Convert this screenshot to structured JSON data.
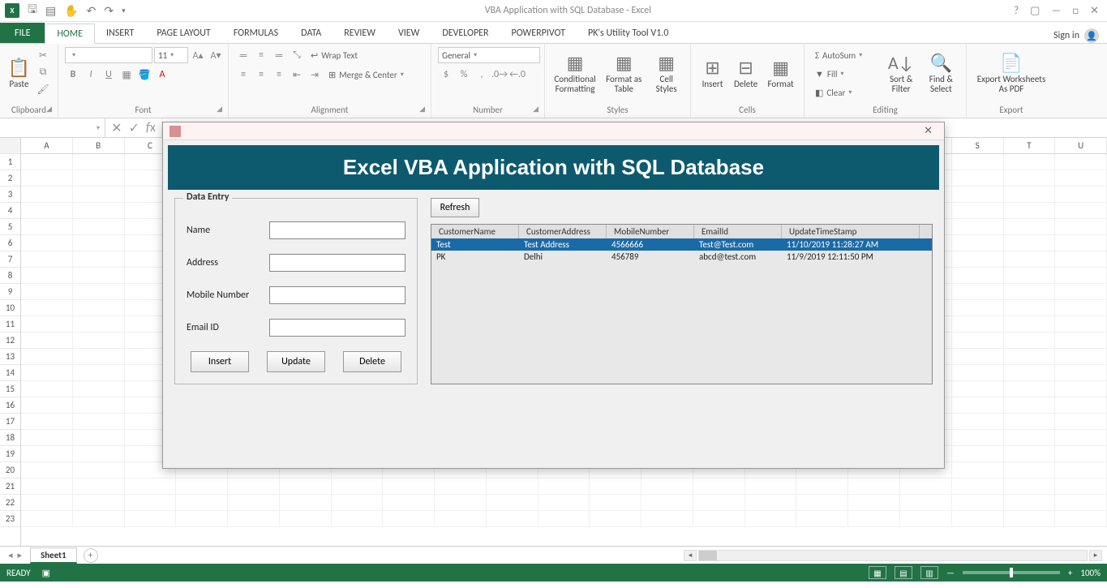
{
  "app": {
    "title": "VBA Application with SQL Database - Excel",
    "signin": "Sign in"
  },
  "qat_icons": [
    "save",
    "open",
    "touch",
    "undo",
    "redo"
  ],
  "ribbon_tabs": {
    "file": "FILE",
    "items": [
      "HOME",
      "INSERT",
      "PAGE LAYOUT",
      "FORMULAS",
      "DATA",
      "REVIEW",
      "VIEW",
      "DEVELOPER",
      "POWERPIVOT",
      "PK's Utility Tool V1.0"
    ],
    "active": "HOME"
  },
  "ribbon": {
    "clipboard": {
      "label": "Clipboard",
      "paste": "Paste"
    },
    "font": {
      "label": "Font",
      "name": "",
      "size": "11"
    },
    "alignment": {
      "label": "Alignment",
      "wrap": "Wrap Text",
      "merge": "Merge & Center"
    },
    "number": {
      "label": "Number",
      "format": "General"
    },
    "styles": {
      "label": "Styles",
      "cond": "Conditional Formatting",
      "table": "Format as Table",
      "cell": "Cell Styles"
    },
    "cells": {
      "label": "Cells",
      "insert": "Insert",
      "delete": "Delete",
      "format": "Format"
    },
    "editing": {
      "label": "Editing",
      "autosum": "AutoSum",
      "fill": "Fill",
      "clear": "Clear",
      "sort": "Sort & Filter",
      "find": "Find & Select"
    },
    "export": {
      "label": "Export",
      "btn": "Export Worksheets As PDF"
    }
  },
  "columns": [
    "A",
    "B",
    "C",
    "",
    "",
    "",
    "",
    "",
    "",
    "",
    "",
    "",
    "",
    "",
    "",
    "",
    "",
    "",
    "S",
    "T",
    "U"
  ],
  "rows": 23,
  "userform": {
    "banner": "Excel VBA Application with SQL Database",
    "fieldset": "Data Entry",
    "labels": {
      "name": "Name",
      "address": "Address",
      "mobile": "Mobile Number",
      "email": "Email ID"
    },
    "values": {
      "name": "",
      "address": "",
      "mobile": "",
      "email": ""
    },
    "buttons": {
      "insert": "Insert",
      "update": "Update",
      "delete": "Delete",
      "refresh": "Refresh"
    },
    "list": {
      "headers": [
        "CustomerName",
        "CustomerAddress",
        "MobileNumber",
        "EmailId",
        "UpdateTimeStamp"
      ],
      "rows": [
        {
          "sel": true,
          "cells": [
            "Test",
            "Test Address",
            "4566666",
            "Test@Test.com",
            "11/10/2019 11:28:27 AM"
          ]
        },
        {
          "sel": false,
          "cells": [
            "PK",
            "Delhi",
            "456789",
            "abcd@test.com",
            "11/9/2019 12:11:50 PM"
          ]
        }
      ]
    }
  },
  "sheet": {
    "name": "Sheet1"
  },
  "status": {
    "ready": "READY",
    "zoom": "100%"
  }
}
